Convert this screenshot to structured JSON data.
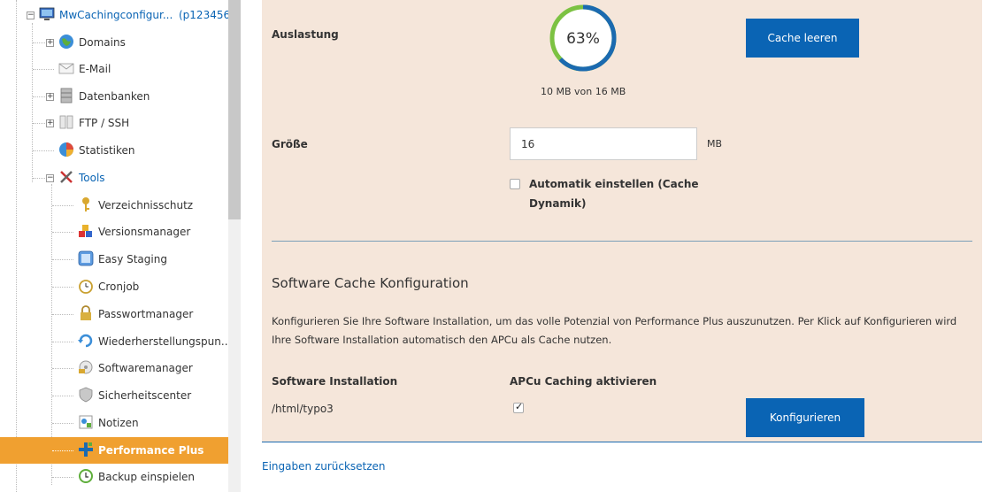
{
  "sidebar": {
    "root": {
      "label": "MwCachingconfigur...",
      "id": "(p123456)"
    },
    "items": [
      {
        "label": "Domains",
        "icon": "globe-icon"
      },
      {
        "label": "E-Mail",
        "icon": "envelope-icon"
      },
      {
        "label": "Datenbanken",
        "icon": "database-icon"
      },
      {
        "label": "FTP / SSH",
        "icon": "folder-icon"
      },
      {
        "label": "Statistiken",
        "icon": "pie-chart-icon"
      },
      {
        "label": "Tools",
        "icon": "tools-icon"
      }
    ],
    "tools": [
      {
        "label": "Verzeichnisschutz",
        "icon": "key-icon"
      },
      {
        "label": "Versionsmanager",
        "icon": "blocks-icon"
      },
      {
        "label": "Easy Staging",
        "icon": "staging-icon"
      },
      {
        "label": "Cronjob",
        "icon": "clock-icon"
      },
      {
        "label": "Passwortmanager",
        "icon": "lock-icon"
      },
      {
        "label": "Wiederherstellungspun...",
        "icon": "restore-icon"
      },
      {
        "label": "Softwaremanager",
        "icon": "software-icon"
      },
      {
        "label": "Sicherheitscenter",
        "icon": "shield-icon"
      },
      {
        "label": "Notizen",
        "icon": "notes-icon"
      },
      {
        "label": "Performance Plus",
        "icon": "plus-icon"
      },
      {
        "label": "Backup einspielen",
        "icon": "backup-icon"
      }
    ],
    "active": "Performance Plus"
  },
  "cache": {
    "usage_label": "Auslastung",
    "usage_percent": 63,
    "usage_percent_text": "63%",
    "usage_text": "10 MB von 16 MB",
    "clear_button": "Cache leeren",
    "size_label": "Größe",
    "size_value": "16",
    "size_unit": "MB",
    "auto_label_line1": "Automatik einstellen (Cache",
    "auto_label_line2": "Dynamik)",
    "auto_checked": false
  },
  "software": {
    "heading": "Software Cache Konfiguration",
    "desc_line1": "Konfigurieren Sie Ihre Software Installation, um das volle Potenzial von Performance Plus auszunutzen. Per Klick auf Konfigurieren wird",
    "desc_line2": "Ihre Software Installation automatisch den APCu als Cache nutzen.",
    "col_install": "Software Installation",
    "col_apcu": "APCu Caching aktivieren",
    "row_path": "/html/typo3",
    "row_apcu_checked": true,
    "configure_button": "Konfigurieren"
  },
  "reset_link": "Eingaben zurücksetzen",
  "colors": {
    "accent": "#0a64b4",
    "panel_bg": "#f5e6da",
    "active_row": "#f0a030",
    "gauge_green": "#7cc242",
    "gauge_blue": "#1b6ab0"
  }
}
